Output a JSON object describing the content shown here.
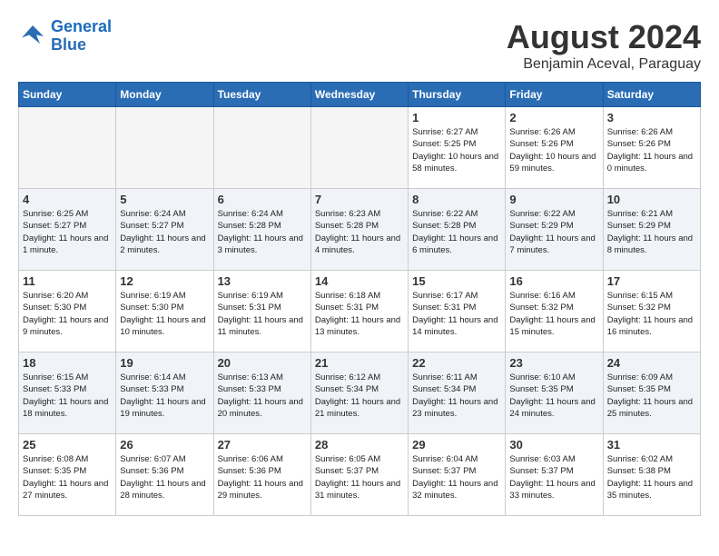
{
  "logo": {
    "text_general": "General",
    "text_blue": "Blue"
  },
  "header": {
    "month_year": "August 2024",
    "location": "Benjamin Aceval, Paraguay"
  },
  "days_of_week": [
    "Sunday",
    "Monday",
    "Tuesday",
    "Wednesday",
    "Thursday",
    "Friday",
    "Saturday"
  ],
  "weeks": [
    [
      {
        "day": "",
        "info": ""
      },
      {
        "day": "",
        "info": ""
      },
      {
        "day": "",
        "info": ""
      },
      {
        "day": "",
        "info": ""
      },
      {
        "day": "1",
        "info": "Sunrise: 6:27 AM\nSunset: 5:25 PM\nDaylight: 10 hours and 58 minutes."
      },
      {
        "day": "2",
        "info": "Sunrise: 6:26 AM\nSunset: 5:26 PM\nDaylight: 10 hours and 59 minutes."
      },
      {
        "day": "3",
        "info": "Sunrise: 6:26 AM\nSunset: 5:26 PM\nDaylight: 11 hours and 0 minutes."
      }
    ],
    [
      {
        "day": "4",
        "info": "Sunrise: 6:25 AM\nSunset: 5:27 PM\nDaylight: 11 hours and 1 minute."
      },
      {
        "day": "5",
        "info": "Sunrise: 6:24 AM\nSunset: 5:27 PM\nDaylight: 11 hours and 2 minutes."
      },
      {
        "day": "6",
        "info": "Sunrise: 6:24 AM\nSunset: 5:28 PM\nDaylight: 11 hours and 3 minutes."
      },
      {
        "day": "7",
        "info": "Sunrise: 6:23 AM\nSunset: 5:28 PM\nDaylight: 11 hours and 4 minutes."
      },
      {
        "day": "8",
        "info": "Sunrise: 6:22 AM\nSunset: 5:28 PM\nDaylight: 11 hours and 6 minutes."
      },
      {
        "day": "9",
        "info": "Sunrise: 6:22 AM\nSunset: 5:29 PM\nDaylight: 11 hours and 7 minutes."
      },
      {
        "day": "10",
        "info": "Sunrise: 6:21 AM\nSunset: 5:29 PM\nDaylight: 11 hours and 8 minutes."
      }
    ],
    [
      {
        "day": "11",
        "info": "Sunrise: 6:20 AM\nSunset: 5:30 PM\nDaylight: 11 hours and 9 minutes."
      },
      {
        "day": "12",
        "info": "Sunrise: 6:19 AM\nSunset: 5:30 PM\nDaylight: 11 hours and 10 minutes."
      },
      {
        "day": "13",
        "info": "Sunrise: 6:19 AM\nSunset: 5:31 PM\nDaylight: 11 hours and 11 minutes."
      },
      {
        "day": "14",
        "info": "Sunrise: 6:18 AM\nSunset: 5:31 PM\nDaylight: 11 hours and 13 minutes."
      },
      {
        "day": "15",
        "info": "Sunrise: 6:17 AM\nSunset: 5:31 PM\nDaylight: 11 hours and 14 minutes."
      },
      {
        "day": "16",
        "info": "Sunrise: 6:16 AM\nSunset: 5:32 PM\nDaylight: 11 hours and 15 minutes."
      },
      {
        "day": "17",
        "info": "Sunrise: 6:15 AM\nSunset: 5:32 PM\nDaylight: 11 hours and 16 minutes."
      }
    ],
    [
      {
        "day": "18",
        "info": "Sunrise: 6:15 AM\nSunset: 5:33 PM\nDaylight: 11 hours and 18 minutes."
      },
      {
        "day": "19",
        "info": "Sunrise: 6:14 AM\nSunset: 5:33 PM\nDaylight: 11 hours and 19 minutes."
      },
      {
        "day": "20",
        "info": "Sunrise: 6:13 AM\nSunset: 5:33 PM\nDaylight: 11 hours and 20 minutes."
      },
      {
        "day": "21",
        "info": "Sunrise: 6:12 AM\nSunset: 5:34 PM\nDaylight: 11 hours and 21 minutes."
      },
      {
        "day": "22",
        "info": "Sunrise: 6:11 AM\nSunset: 5:34 PM\nDaylight: 11 hours and 23 minutes."
      },
      {
        "day": "23",
        "info": "Sunrise: 6:10 AM\nSunset: 5:35 PM\nDaylight: 11 hours and 24 minutes."
      },
      {
        "day": "24",
        "info": "Sunrise: 6:09 AM\nSunset: 5:35 PM\nDaylight: 11 hours and 25 minutes."
      }
    ],
    [
      {
        "day": "25",
        "info": "Sunrise: 6:08 AM\nSunset: 5:35 PM\nDaylight: 11 hours and 27 minutes."
      },
      {
        "day": "26",
        "info": "Sunrise: 6:07 AM\nSunset: 5:36 PM\nDaylight: 11 hours and 28 minutes."
      },
      {
        "day": "27",
        "info": "Sunrise: 6:06 AM\nSunset: 5:36 PM\nDaylight: 11 hours and 29 minutes."
      },
      {
        "day": "28",
        "info": "Sunrise: 6:05 AM\nSunset: 5:37 PM\nDaylight: 11 hours and 31 minutes."
      },
      {
        "day": "29",
        "info": "Sunrise: 6:04 AM\nSunset: 5:37 PM\nDaylight: 11 hours and 32 minutes."
      },
      {
        "day": "30",
        "info": "Sunrise: 6:03 AM\nSunset: 5:37 PM\nDaylight: 11 hours and 33 minutes."
      },
      {
        "day": "31",
        "info": "Sunrise: 6:02 AM\nSunset: 5:38 PM\nDaylight: 11 hours and 35 minutes."
      }
    ]
  ]
}
